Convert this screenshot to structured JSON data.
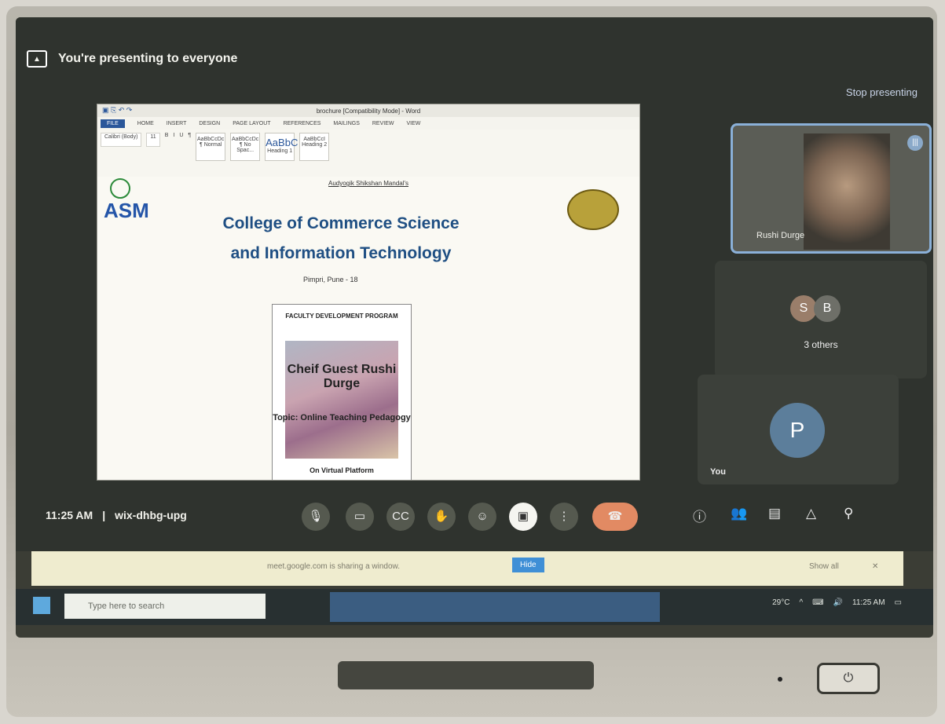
{
  "meet": {
    "presenting_banner": "You're presenting to everyone",
    "stop_presenting": "Stop presenting",
    "time": "11:25 AM",
    "meeting_code": "wix-dhbg-upg",
    "participant_name": "Rushi Durge",
    "others_label": "3 others",
    "avatar_s": "S",
    "avatar_b": "B",
    "avatar_p": "P",
    "you_label": "You"
  },
  "word": {
    "window_title": "brochure [Compatibility Mode] - Word",
    "tabs": [
      "FILE",
      "HOME",
      "INSERT",
      "DESIGN",
      "PAGE LAYOUT",
      "REFERENCES",
      "MAILINGS",
      "REVIEW",
      "VIEW"
    ],
    "font_name": "Calibri (Body)",
    "font_size": "11",
    "styles": [
      "AaBbCcDc",
      "AaBbCcDc",
      "AaBbC",
      "AaBbCcI"
    ],
    "style_names": [
      "¶ Normal",
      "¶ No Spac...",
      "Heading 1",
      "Heading 2"
    ]
  },
  "document": {
    "header": "Audyogik Shikshan Mandal's",
    "logo": "ASM",
    "college_line1": "College of Commerce Science",
    "college_line2": "and Information Technology",
    "place": "Pimpri, Pune - 18",
    "poster_title": "FACULTY DEVELOPMENT PROGRAM",
    "poster_guest": "Cheif Guest Rushi Durge",
    "poster_topic": "Topic: Online Teaching Pedagogy",
    "poster_foot": "On Virtual Platform"
  },
  "notice": {
    "text": "meet.google.com is sharing a window.",
    "hide": "Hide",
    "show_all": "Show all"
  },
  "taskbar": {
    "search_placeholder": "Type here to search",
    "weather": "29°C",
    "clock_time": "11:25 AM"
  }
}
